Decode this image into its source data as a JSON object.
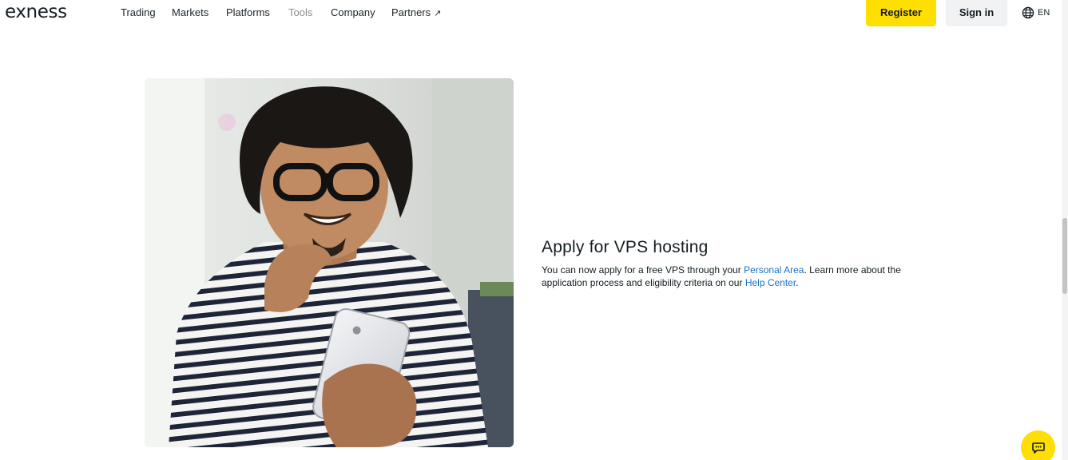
{
  "header": {
    "logo": "exness",
    "nav": [
      {
        "label": "Trading"
      },
      {
        "label": "Markets"
      },
      {
        "label": "Platforms"
      },
      {
        "label": "Tools"
      },
      {
        "label": "Company"
      },
      {
        "label": "Partners",
        "external": true
      }
    ],
    "nav_external_arrow": "↗",
    "register_label": "Register",
    "signin_label": "Sign in",
    "language": "EN"
  },
  "vps": {
    "title": "Apply for VPS hosting",
    "text_1": "You can now apply for a free VPS through your ",
    "link_personal_area": "Personal Area",
    "text_2": ". Learn more about the application process and eligibility criteria on our ",
    "link_help_center": "Help Center",
    "text_3": "."
  },
  "icons": {
    "globe": "globe-icon",
    "chat": "chat-icon",
    "external": "external-link-arrow-icon"
  },
  "colors": {
    "brand_yellow": "#ffde02",
    "signin_bg": "#f1f2f3",
    "link_blue": "#1a73c8",
    "text_dark": "#141d22",
    "nav_muted": "#8a9095"
  }
}
